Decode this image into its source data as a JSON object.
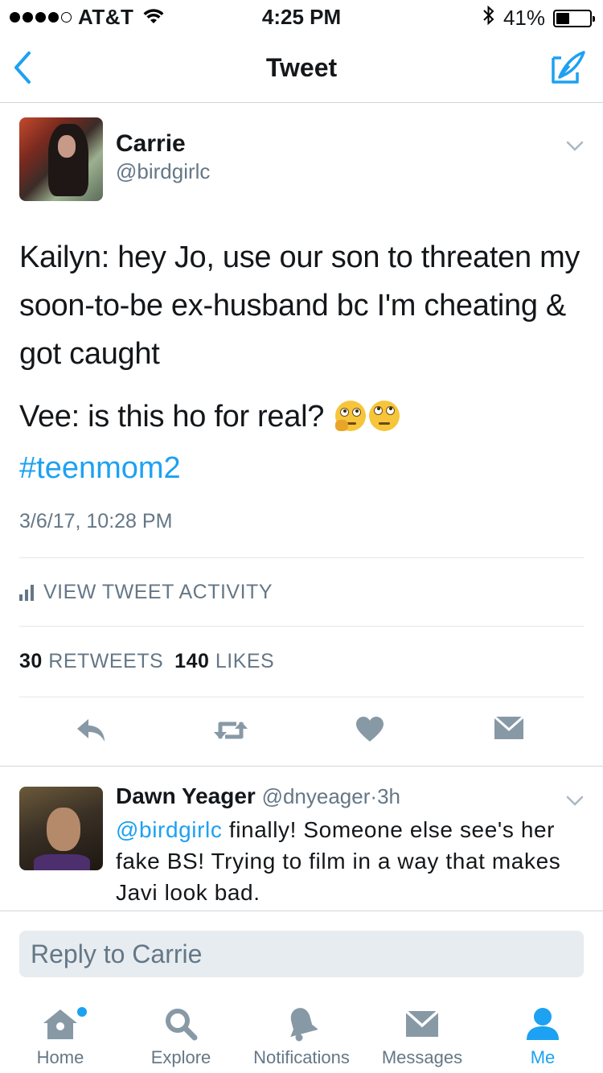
{
  "status_bar": {
    "carrier": "AT&T",
    "time": "4:25 PM",
    "battery": "41%",
    "battery_level": 0.41
  },
  "nav": {
    "title": "Tweet"
  },
  "tweet": {
    "author_name": "Carrie",
    "author_handle": "@birdgirlc",
    "text_line1": "Kailyn: hey Jo, use our son to threaten my soon-to-be ex-husband bc I'm cheating & got caught",
    "text_line2": "Vee: is this ho for real?",
    "hashtag": "#teenmom2",
    "timestamp": "3/6/17, 10:28 PM",
    "activity_label": "VIEW TWEET ACTIVITY",
    "retweets_count": "30",
    "retweets_label": "RETWEETS",
    "likes_count": "140",
    "likes_label": "LIKES",
    "emojis": [
      "thinking-face",
      "face-with-rolling-eyes"
    ]
  },
  "reply_tweet": {
    "author_name": "Dawn Yeager",
    "author_handle": "@dnyeager",
    "separator": "·",
    "age": "3h",
    "mention": "@birdgirlc",
    "text": " finally! Someone else see's her fake BS! Trying to film in a way that makes Javi look bad."
  },
  "composer": {
    "placeholder": "Reply to Carrie"
  },
  "tab_bar": {
    "home": "Home",
    "explore": "Explore",
    "notifications": "Notifications",
    "messages": "Messages",
    "me": "Me"
  },
  "colors": {
    "accent": "#1da1f2",
    "secondary_text": "#657786",
    "input_bg": "#e6ecf0"
  }
}
